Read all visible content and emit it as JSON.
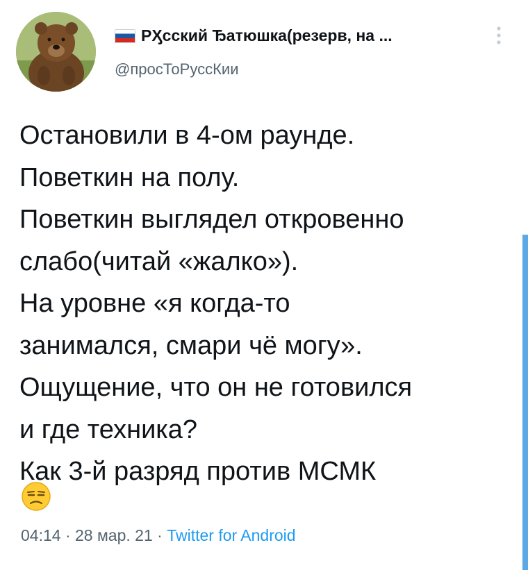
{
  "author": {
    "display_name": "РӼсский Ђатюшка(резерв, на ...",
    "handle": "@просТоРуссКии"
  },
  "icons": {
    "avatar": "bear-avatar",
    "flag": "russian-flag-icon",
    "more": "vertical-more-icon",
    "emoji": "unamused-face-emoji"
  },
  "tweet": {
    "lines": [
      "Остановили в 4-ом раунде.",
      "Поветкин на полу.",
      "Поветкин выглядел откровенно",
      "слабо(читай «жалко»).",
      "На уровне «я когда-то",
      "занимался, смари чё могу».",
      "Ощущение, что он не готовился",
      "и где техника?",
      "Как  3-й разряд против МСМК"
    ]
  },
  "meta": {
    "time": "04:14",
    "separator": "·",
    "date": "28 мар. 21",
    "source": "Twitter for Android"
  },
  "colors": {
    "text": "#0f1419",
    "secondary": "#536471",
    "link": "#1d9bf0",
    "scroll_indicator": "#5da9e6"
  }
}
